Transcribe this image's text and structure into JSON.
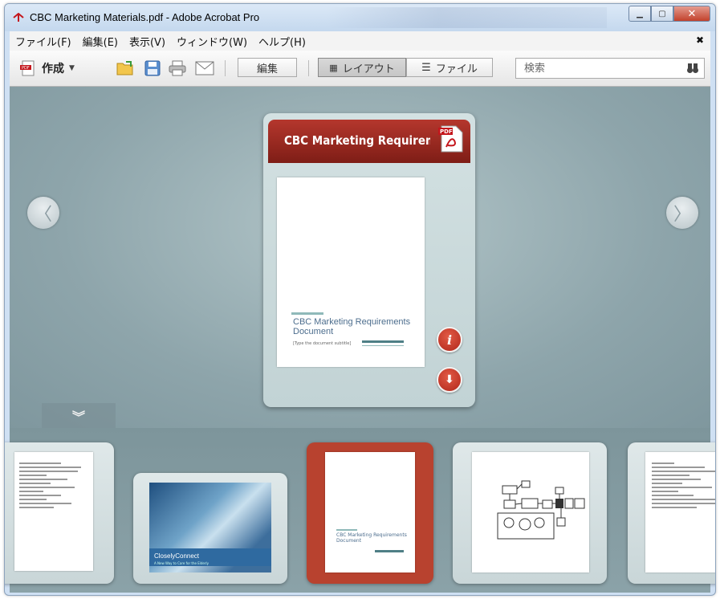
{
  "window": {
    "title": "CBC Marketing Materials.pdf - Adobe Acrobat Pro",
    "minimize_icon": "minimize-icon",
    "maximize_icon": "maximize-icon",
    "close_icon": "close-icon"
  },
  "menu": {
    "items": [
      "ファイル(F)",
      "編集(E)",
      "表示(V)",
      "ウィンドウ(W)",
      "ヘルプ(H)"
    ],
    "close_glyph": "✖"
  },
  "toolbar": {
    "create_label": "作成",
    "edit_label": "編集",
    "layout_label": "レイアウト",
    "files_label": "ファイル",
    "search_placeholder": "検索"
  },
  "viewer": {
    "card_title": "CBC Marketing Requirements",
    "page_title": "CBC Marketing Requirements Document",
    "page_subtitle": "[Type the document subtitle]"
  },
  "filmstrip": {
    "thumb2_title": "CloselyConnect",
    "thumb2_subtitle": "A New Way to Care for the Elderly",
    "thumb3_title": "CBC Marketing Requirements Document"
  },
  "colors": {
    "accent": "#b8422f",
    "viewer_bg": "#8ea5ab"
  }
}
